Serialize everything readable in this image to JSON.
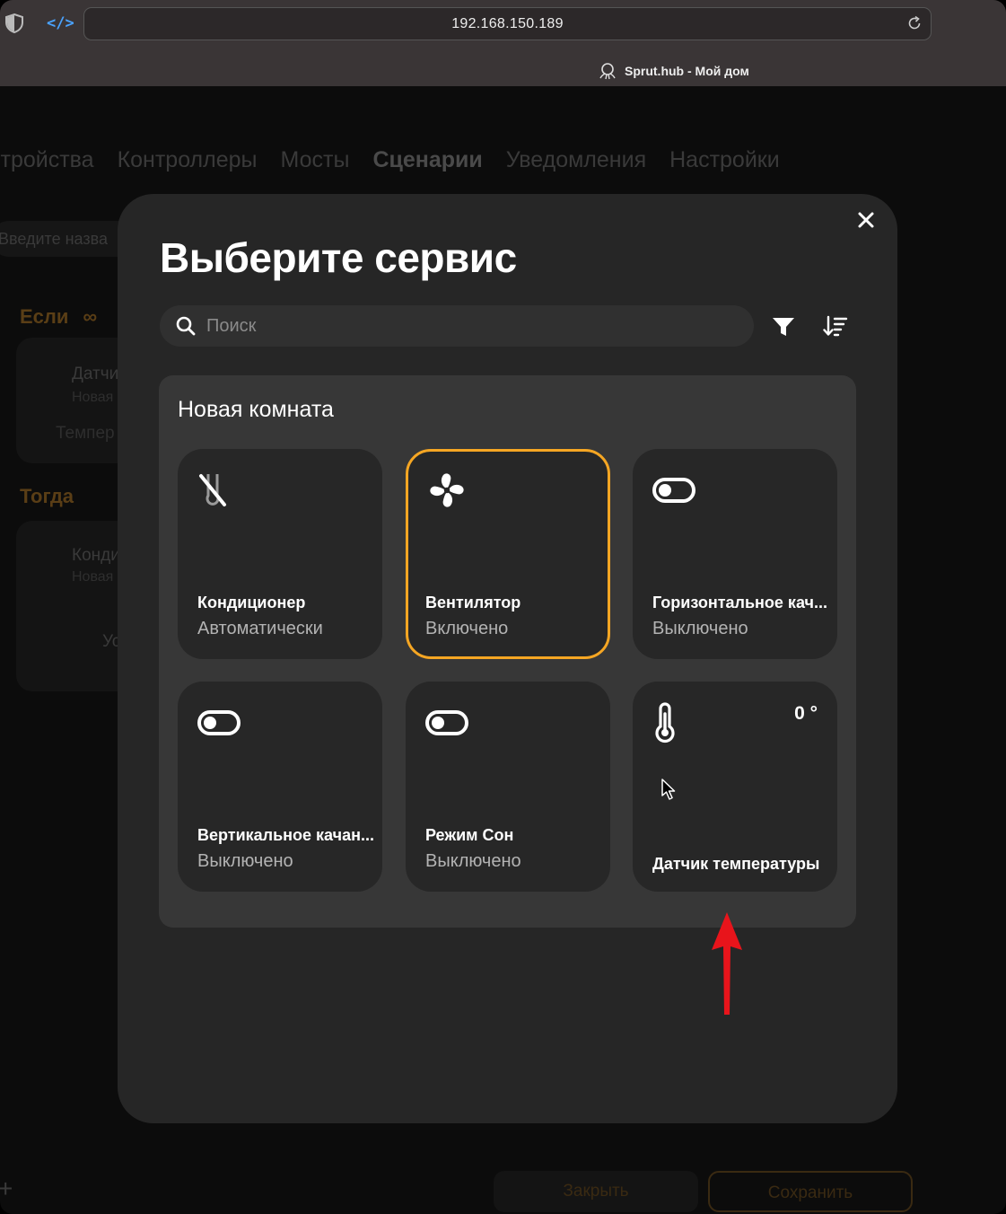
{
  "browser": {
    "url": "192.168.150.189",
    "tab_title": "Sprut.hub - Мой дом"
  },
  "background": {
    "nav": [
      "стройства",
      "Контроллеры",
      "Мосты",
      "Сценарии",
      "Уведомления",
      "Настройки"
    ],
    "search_text": "Введите назва",
    "if_label": "Если",
    "then_label": "Тогда",
    "card1_title": "Датчи",
    "card1_sub": "Новая",
    "card1_extra": "Темпер",
    "card2_title": "Конди",
    "card2_sub": "Новая",
    "card2_extra": "Ус",
    "close_label": "Закрыть",
    "save_label": "Сохранить"
  },
  "modal": {
    "title": "Выберите сервис",
    "search_placeholder": "Поиск",
    "room": {
      "title": "Новая комната",
      "services": [
        {
          "name": "Кондиционер",
          "state": "Автоматически",
          "icon": "ac-off-icon",
          "selected": false
        },
        {
          "name": "Вентилятор",
          "state": "Включено",
          "icon": "fan-icon",
          "selected": true
        },
        {
          "name": "Горизонтальное кач...",
          "state": "Выключено",
          "icon": "toggle-icon",
          "selected": false
        },
        {
          "name": "Вертикальное качан...",
          "state": "Выключено",
          "icon": "toggle-icon",
          "selected": false
        },
        {
          "name": "Режим Сон",
          "state": "Выключено",
          "icon": "toggle-icon",
          "selected": false
        },
        {
          "name": "Датчик температуры",
          "value": "0 °",
          "icon": "thermometer-icon",
          "selected": false
        }
      ]
    }
  },
  "colors": {
    "accent": "#f5a623",
    "annotation_arrow": "#e8141b",
    "modal_bg": "#262626",
    "tile_bg": "#272727"
  }
}
